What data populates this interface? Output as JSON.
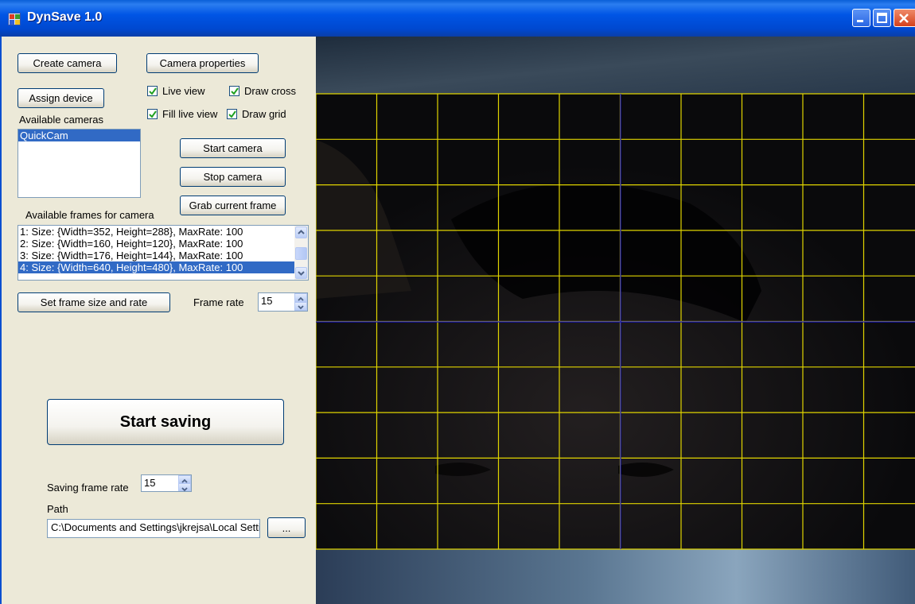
{
  "window": {
    "title": "DynSave 1.0",
    "colors": {
      "titlebar": "#0055e5",
      "client": "#ece9d8",
      "selection": "#316ac5",
      "grid": "#e0d400",
      "cross": "#1010c8"
    }
  },
  "buttons": {
    "create_camera": "Create camera",
    "camera_properties": "Camera properties",
    "assign_device": "Assign device",
    "start_camera": "Start camera",
    "stop_camera": "Stop camera",
    "grab_frame": "Grab current frame",
    "set_frame_size": "Set frame size and rate",
    "start_saving": "Start saving",
    "browse": "..."
  },
  "checkboxes": [
    {
      "label": "Live view",
      "checked": true
    },
    {
      "label": "Draw cross",
      "checked": true
    },
    {
      "label": "Fill live view",
      "checked": true
    },
    {
      "label": "Draw grid",
      "checked": true
    }
  ],
  "cameras": {
    "label": "Available cameras",
    "items": [
      "QuickCam"
    ],
    "selected_index": 0
  },
  "frames": {
    "label": "Available frames for camera",
    "items": [
      "1: Size: {Width=352, Height=288}, MaxRate: 100",
      "2: Size: {Width=160, Height=120}, MaxRate: 100",
      "3: Size: {Width=176, Height=144}, MaxRate: 100",
      "4: Size: {Width=640, Height=480}, MaxRate: 100"
    ],
    "selected_index": 3
  },
  "frame_rate": {
    "label": "Frame rate",
    "value": "15"
  },
  "saving_frame_rate": {
    "label": "Saving frame rate",
    "value": "15"
  },
  "path": {
    "label": "Path",
    "value": "C:\\Documents and Settings\\jkrejsa\\Local Settings"
  },
  "preview": {
    "name": "Live camera view",
    "grid_columns": 10,
    "grid_rows": 10
  }
}
